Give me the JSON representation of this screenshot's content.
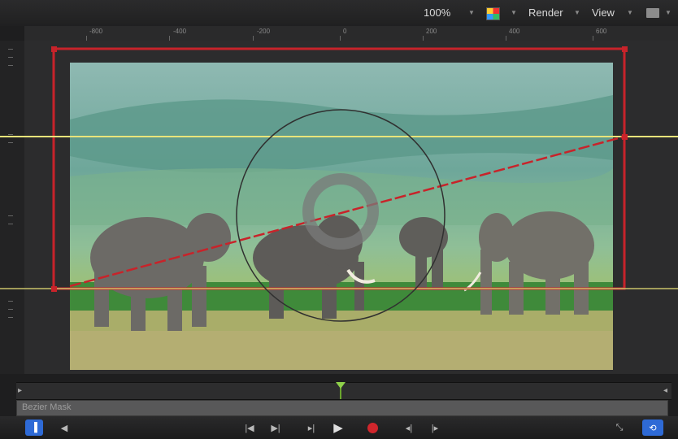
{
  "toolbar": {
    "zoom_label": "100%",
    "render_label": "Render",
    "view_label": "View"
  },
  "ruler": {
    "labels": [
      "-800",
      "-400",
      "-200",
      "0",
      "200",
      "400",
      "600"
    ]
  },
  "timeline": {
    "track_label": "Bezier Mask"
  },
  "colors": {
    "mask_red": "#c8232a",
    "guide_yellow": "#e9e47a",
    "playhead_green": "#8fd14a",
    "accent_blue": "#2e6ad6"
  },
  "icons": [
    "zoom-dropdown-arrow",
    "channel-color-icon",
    "render-dropdown-arrow",
    "view-dropdown-arrow",
    "layout-icon",
    "go-to-start-icon",
    "go-to-end-icon",
    "step-back-icon",
    "play-icon",
    "record-icon",
    "prev-keyframe-icon",
    "next-keyframe-icon",
    "fullscreen-icon",
    "loop-icon",
    "audio-icon",
    "layers-toggle-icon"
  ]
}
